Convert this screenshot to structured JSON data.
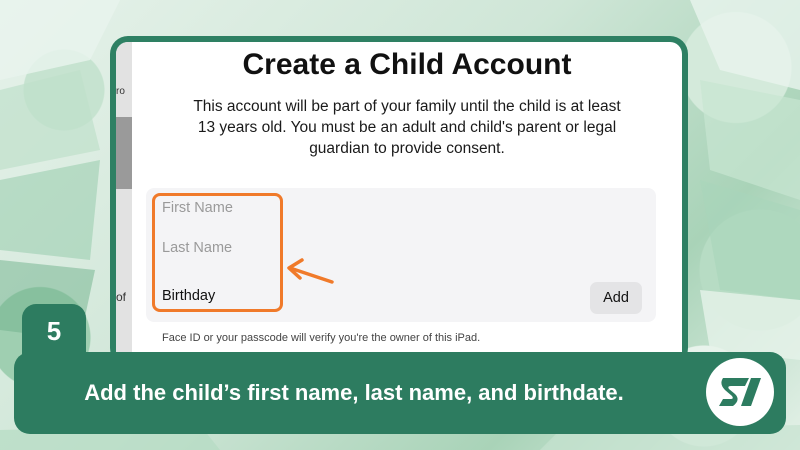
{
  "screen": {
    "title": "Create a Child Account",
    "description": "This account will be part of your family until the child is at least 13 years old. You must be an adult and child's parent or legal guardian to provide consent.",
    "side_text_top": "ro",
    "side_text_bottom": "of",
    "form": {
      "first_name_placeholder": "First Name",
      "last_name_placeholder": "Last Name",
      "birthday_label": "Birthday",
      "add_button": "Add"
    },
    "footnote": "Face ID or your passcode will verify you're the owner of this iPad."
  },
  "step": {
    "number": "5",
    "caption": "Add the child’s first name, last name, and birthdate."
  },
  "colors": {
    "accent": "#2d7c60",
    "highlight": "#f07a2a"
  },
  "icons": {
    "arrow": "arrow-left-icon",
    "logo": "si-logo-icon"
  }
}
